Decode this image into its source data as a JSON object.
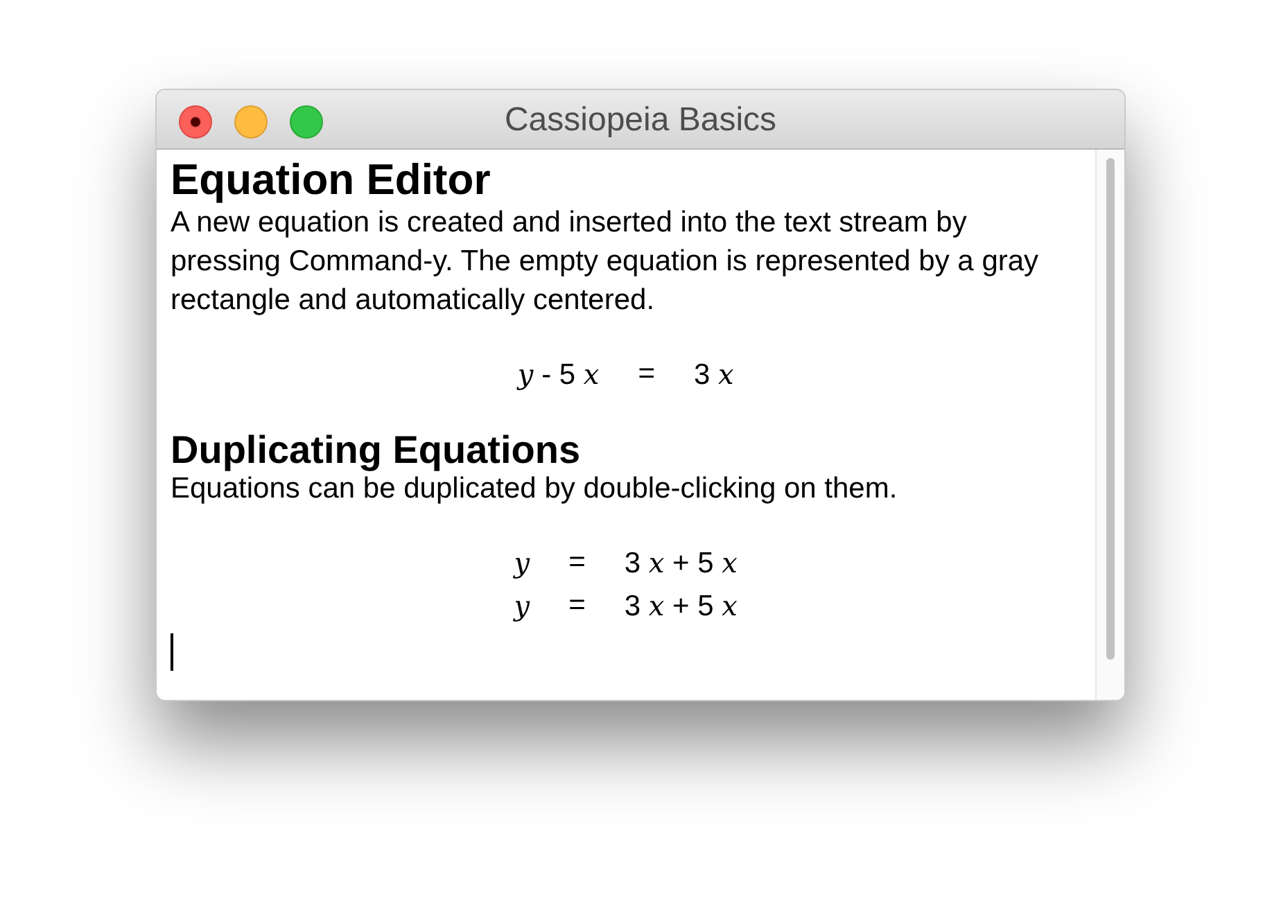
{
  "window": {
    "title": "Cassiopeia Basics"
  },
  "sections": [
    {
      "heading": "Equation Editor",
      "paragraph": "A new equation is created and inserted into the text stream by pressing Command-y. The empty equation is represented by a gray rectangle and automatically centered.",
      "equations": [
        {
          "lhs": "*y* - 5 *x*",
          "relation": "=",
          "rhs": "3 *x*"
        }
      ]
    },
    {
      "heading": "Duplicating Equations",
      "paragraph": "Equations can be duplicated by double-clicking on them.",
      "equations": [
        {
          "lhs": "*y*",
          "relation": "=",
          "rhs": "3 *x* + 5 *x*"
        },
        {
          "lhs": "*y*",
          "relation": "=",
          "rhs": "3 *x* + 5 *x*"
        }
      ]
    }
  ]
}
